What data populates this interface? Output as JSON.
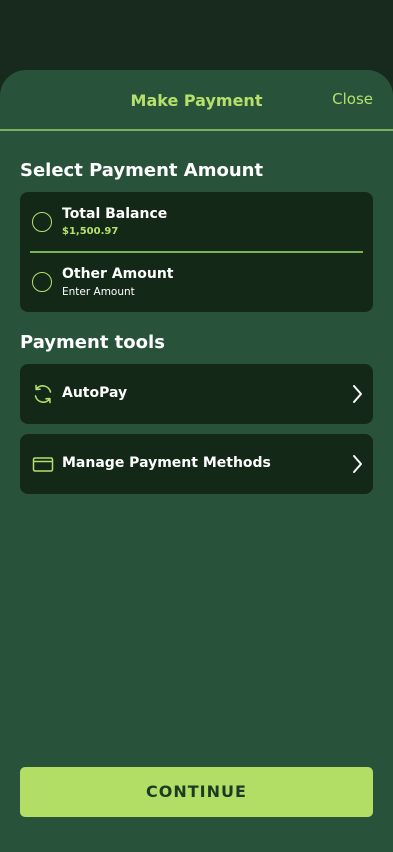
{
  "header": {
    "title": "Make Payment",
    "close_label": "Close"
  },
  "amount_section": {
    "title": "Select Payment Amount",
    "options": [
      {
        "label": "Total Balance",
        "sub": "$1,500.97",
        "selected": false
      },
      {
        "label": "Other Amount",
        "sub": "Enter Amount",
        "selected": false
      }
    ]
  },
  "tools_section": {
    "title": "Payment tools",
    "items": [
      {
        "label": "AutoPay",
        "icon": "refresh-icon"
      },
      {
        "label": "Manage Payment Methods",
        "icon": "wallet-icon"
      }
    ]
  },
  "footer": {
    "continue_label": "CONTINUE"
  },
  "colors": {
    "accent": "#b6e06b",
    "sheet_bg": "#28533a",
    "card_bg": "#142818",
    "button_bg": "#b2de66"
  }
}
